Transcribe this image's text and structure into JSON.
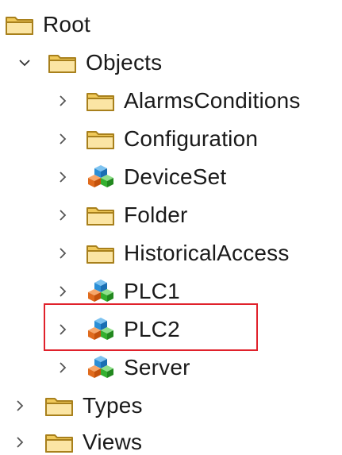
{
  "tree": {
    "root": {
      "label": "Root",
      "icon": "folder-icon"
    },
    "objects": {
      "label": "Objects",
      "icon": "folder-icon",
      "expanded": true
    },
    "children": [
      {
        "label": "AlarmsConditions",
        "icon": "folder-icon"
      },
      {
        "label": "Configuration",
        "icon": "folder-icon"
      },
      {
        "label": "DeviceSet",
        "icon": "object-cubes-icon"
      },
      {
        "label": "Folder",
        "icon": "folder-icon"
      },
      {
        "label": "HistoricalAccess",
        "icon": "folder-icon"
      },
      {
        "label": "PLC1",
        "icon": "object-cubes-icon"
      },
      {
        "label": "PLC2",
        "icon": "object-cubes-icon",
        "highlighted": true
      },
      {
        "label": "Server",
        "icon": "object-cubes-icon"
      }
    ],
    "types": {
      "label": "Types",
      "icon": "folder-icon"
    },
    "views": {
      "label": "Views",
      "icon": "folder-icon"
    }
  },
  "colors": {
    "highlight_border": "#e0212b",
    "folder_fill": "#f5d57a",
    "folder_stroke": "#b88a1a",
    "chevron": "#555555"
  }
}
